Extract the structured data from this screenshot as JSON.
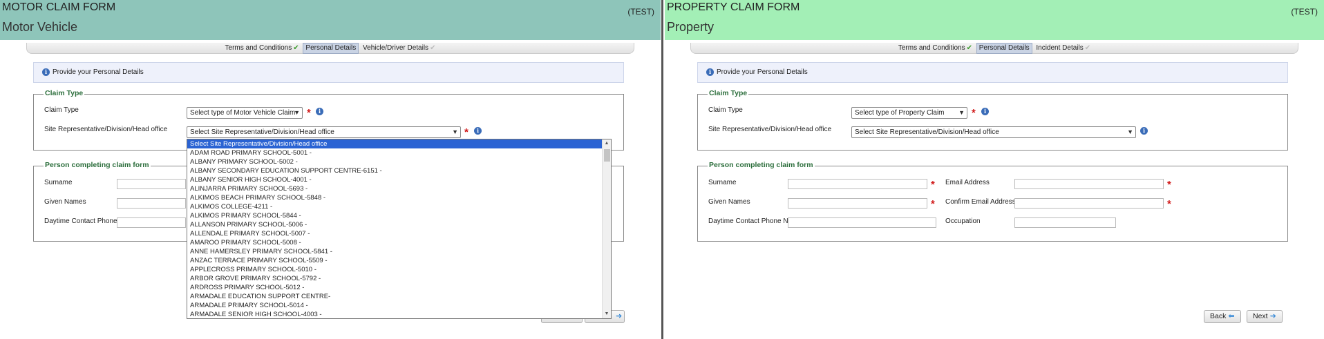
{
  "motor": {
    "title": "MOTOR CLAIM FORM",
    "subtitle": "Motor Vehicle",
    "test_tag": "(TEST)",
    "steps": [
      "Terms and Conditions",
      "Personal Details",
      "Vehicle/Driver Details"
    ],
    "info": "Provide your Personal Details",
    "claim_type_legend": "Claim Type",
    "claim_type_label": "Claim Type",
    "claim_type_value": "Select type of Motor Vehicle Claim",
    "site_label": "Site Representative/Division/Head office",
    "site_value": "Select Site Representative/Division/Head office",
    "person_legend": "Person completing claim form",
    "surname_label": "Surname",
    "given_names_label": "Given Names",
    "phone_label": "Daytime Contact Phone No",
    "site_options": [
      "Select Site Representative/Division/Head office",
      "ADAM ROAD PRIMARY SCHOOL-5001 -",
      "ALBANY PRIMARY SCHOOL-5002 -",
      "ALBANY SECONDARY EDUCATION SUPPORT CENTRE-6151 -",
      "ALBANY SENIOR HIGH SCHOOL-4001 -",
      "ALINJARRA PRIMARY SCHOOL-5693 -",
      "ALKIMOS BEACH PRIMARY SCHOOL-5848 -",
      "ALKIMOS COLLEGE-4211 -",
      "ALKIMOS PRIMARY SCHOOL-5844 -",
      "ALLANSON PRIMARY SCHOOL-5006 -",
      "ALLENDALE PRIMARY SCHOOL-5007 -",
      "AMAROO PRIMARY SCHOOL-5008 -",
      "ANNE HAMERSLEY PRIMARY SCHOOL-5841 -",
      "ANZAC TERRACE PRIMARY SCHOOL-5509 -",
      "APPLECROSS PRIMARY SCHOOL-5010 -",
      "ARBOR GROVE PRIMARY SCHOOL-5792 -",
      "ARDROSS PRIMARY SCHOOL-5012 -",
      "ARMADALE EDUCATION SUPPORT CENTRE-",
      "ARMADALE PRIMARY SCHOOL-5014 -",
      "ARMADALE SENIOR HIGH SCHOOL-4003 -"
    ]
  },
  "property": {
    "title": "PROPERTY CLAIM FORM",
    "subtitle": "Property",
    "test_tag": "(TEST)",
    "steps": [
      "Terms and Conditions",
      "Personal Details",
      "Incident Details"
    ],
    "info": "Provide your Personal Details",
    "claim_type_legend": "Claim Type",
    "claim_type_label": "Claim Type",
    "claim_type_value": "Select type of Property Claim",
    "site_label": "Site Representative/Division/Head office",
    "site_value": "Select Site Representative/Division/Head office",
    "person_legend": "Person completing claim form",
    "surname_label": "Surname",
    "given_names_label": "Given Names",
    "phone_label": "Daytime Contact Phone No",
    "email_label": "Email Address",
    "confirm_email_label": "Confirm Email Address",
    "occupation_label": "Occupation",
    "back_label": "Back",
    "next_label": "Next"
  }
}
